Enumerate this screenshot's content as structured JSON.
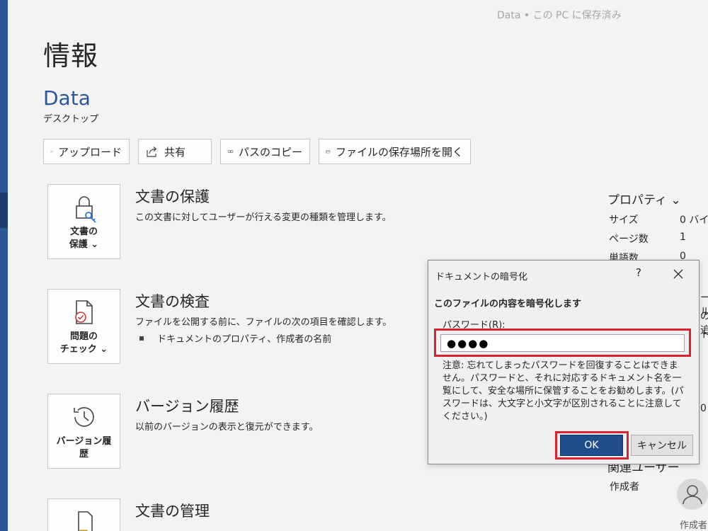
{
  "header": {
    "save_status": "Data • この PC に保存済み"
  },
  "page": {
    "title": "情報",
    "doc_name": "Data",
    "doc_location": "デスクトップ"
  },
  "toolbar": {
    "upload": "アップロード",
    "share": "共有",
    "copy_path": "パスのコピー",
    "open_location": "ファイルの保存場所を開く"
  },
  "sections": {
    "protect": {
      "tile": "文書の\n保護 ⌄",
      "title": "文書の保護",
      "desc": "この文書に対してユーザーが行える変更の種類を管理します。"
    },
    "inspect": {
      "tile": "問題の\nチェック ⌄",
      "title": "文書の検査",
      "desc": "ファイルを公開する前に、ファイルの次の項目を確認します。",
      "bullet": "ドキュメントのプロパティ、作成者の名前"
    },
    "versions": {
      "tile": "バージョン履\n歴",
      "title": "バージョン履歴",
      "desc": "以前のバージョンの表示と復元ができます。"
    },
    "manage": {
      "title": "文書の管理"
    }
  },
  "properties": {
    "header": "プロパティ ⌄",
    "size_label": "サイズ",
    "size_value": "0 バイ",
    "pages_label": "ページ数",
    "pages_value": "1",
    "words_label": "単語数",
    "words_value": "0",
    "related_people_cut": "関連ユーザー",
    "author_label": "作成者",
    "author_cut": "作成者",
    "edge_fragments": [
      "ール",
      "の追",
      "ト",
      "0"
    ]
  },
  "dialog": {
    "title": "ドキュメントの暗号化",
    "help": "?",
    "heading": "このファイルの内容を暗号化します",
    "password_label": "パスワード(R):",
    "password_value": "●●●●",
    "note": "注意: 忘れてしまったパスワードを回復することはできません。パスワードと、それに対応するドキュメント名を一覧にして、安全な場所に保管することをお勧めします。(パスワードは、大文字と小文字が区別されることに注意してください。)",
    "ok": "OK",
    "cancel": "キャンセル"
  },
  "colors": {
    "accent": "#2b579a",
    "highlight": "#d9232e",
    "ok_button": "#1f4e8a"
  }
}
